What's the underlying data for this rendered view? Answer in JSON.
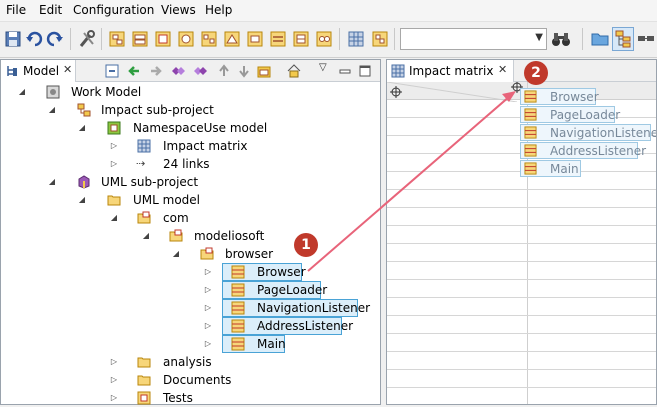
{
  "menu": {
    "file": "File",
    "edit": "Edit",
    "configuration": "Configuration",
    "views": "Views",
    "help": "Help"
  },
  "toolbar": {
    "search_value": ""
  },
  "model_panel": {
    "tab_label": "Model",
    "tree": {
      "work_model": "Work Model",
      "impact_subproject": "Impact sub-project",
      "namespaceuse_model": "NamespaceUse model",
      "impact_matrix": "Impact matrix",
      "links": "24 links",
      "uml_subproject": "UML sub-project",
      "uml_model": "UML model",
      "com": "com",
      "modeliosoft": "modeliosoft",
      "browser_pkg": "browser",
      "classes": [
        "Browser",
        "PageLoader",
        "NavigationListener",
        "AddressListener",
        "Main"
      ],
      "analysis": "analysis",
      "documents": "Documents",
      "tests": "Tests"
    }
  },
  "matrix_panel": {
    "tab_label": "Impact matrix",
    "columns": [
      "Browser",
      "PageLoader",
      "NavigationListener",
      "AddressListener",
      "Main"
    ]
  },
  "callouts": {
    "one": "1",
    "two": "2"
  },
  "colors": {
    "selection": "#dbeefa",
    "selection_border": "#4aa3d6",
    "arrow": "#e8647a",
    "badge": "#c0392b"
  },
  "icons": [
    "save-icon",
    "undo-icon",
    "redo-icon",
    "tools-icon",
    "diagram-icon",
    "binoculars-icon",
    "folder-icon",
    "package-icon",
    "class-icon",
    "matrix-icon",
    "link-icon"
  ]
}
